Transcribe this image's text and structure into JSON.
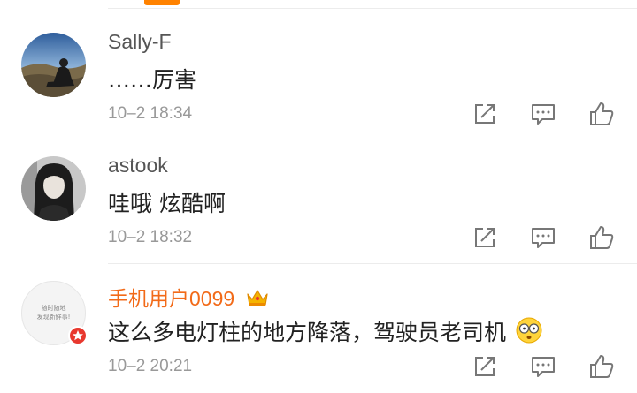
{
  "colors": {
    "accent": "#ff8200",
    "vip_name": "#f26a18",
    "muted": "#999999",
    "badge": "#e8382e"
  },
  "comments": [
    {
      "username": "Sally-F",
      "text": "……厉害",
      "time": "10–2 18:34",
      "actions": [
        "share-icon",
        "reply-icon",
        "like-icon"
      ]
    },
    {
      "username": "astook",
      "text": "哇哦 炫酷啊",
      "time": "10–2 18:32",
      "actions": [
        "share-icon",
        "reply-icon",
        "like-icon"
      ]
    },
    {
      "username": "手机用户0099",
      "text": "这么多电灯柱的地方降落，驾驶员老司机",
      "time": "10–2 20:21",
      "avatar_text_line1": "随时随地",
      "avatar_text_line2": "发现新鲜事!",
      "badges": [
        "crown-icon",
        "verified-badge-icon"
      ],
      "emoji": "shocked-face-icon",
      "actions": [
        "share-icon",
        "reply-icon",
        "like-icon"
      ]
    }
  ]
}
